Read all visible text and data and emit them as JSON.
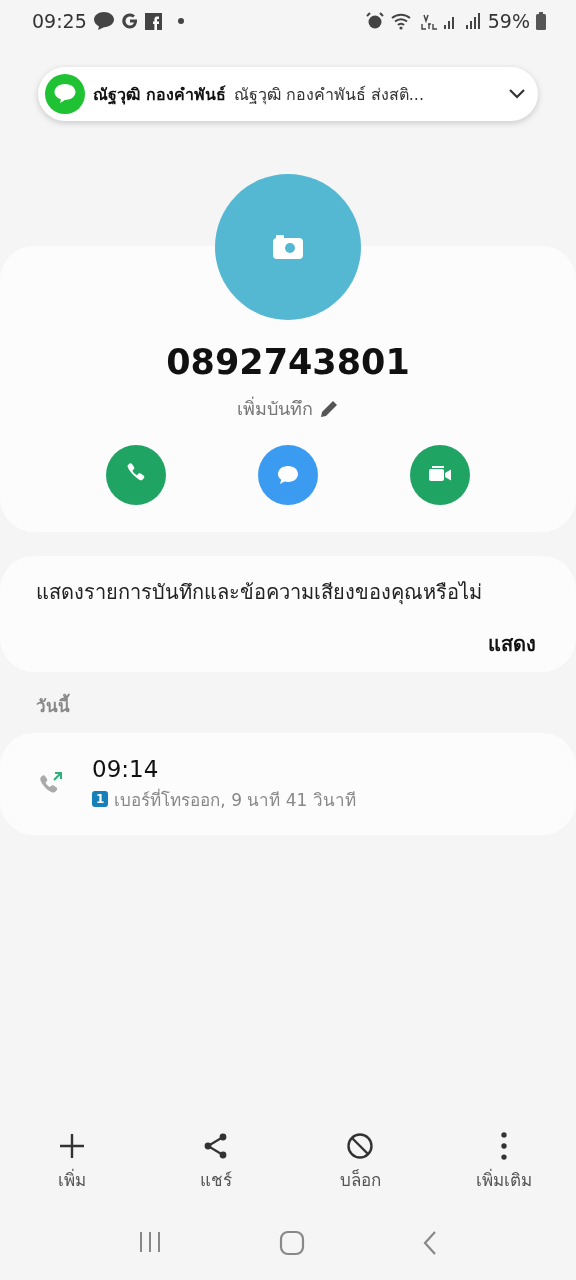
{
  "status_bar": {
    "time": "09:25",
    "battery": "59%"
  },
  "notification": {
    "title": "ณัฐวุฒิ กองคำพันธ์",
    "text": "ณัฐวุฒิ กองคำพันธ์ ส่งสติ..."
  },
  "contact": {
    "number": "0892743801",
    "add_note": "เพิ่มบันทึก",
    "actions": [
      {
        "kind": "call"
      },
      {
        "kind": "message"
      },
      {
        "kind": "video"
      }
    ]
  },
  "prompt": {
    "text": "แสดงรายการบันทึกและข้อความเสียงของคุณหรือไม่",
    "action": "แสดง"
  },
  "log": {
    "heading": "วันนี้",
    "entries": [
      {
        "kind": "outgoing",
        "time": "09:14",
        "sim": "1",
        "detail": "เบอร์ที่โทรออก, 9 นาที 41 วินาที"
      }
    ]
  },
  "toolbar": [
    {
      "kind": "add",
      "label": "เพิ่ม"
    },
    {
      "kind": "share",
      "label": "แชร์"
    },
    {
      "kind": "block",
      "label": "บล็อก"
    },
    {
      "kind": "more",
      "label": "เพิ่มเติม"
    }
  ]
}
